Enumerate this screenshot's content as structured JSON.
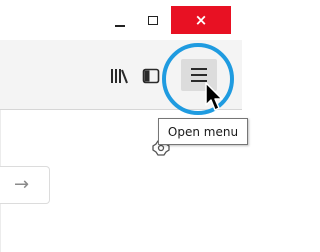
{
  "window_controls": {
    "minimize": "minimize-icon",
    "maximize": "maximize-icon",
    "close": "close-icon",
    "close_glyph": "×",
    "close_color": "#e81123"
  },
  "toolbar": {
    "library": "library-icon",
    "sidebar": "sidebar-icon",
    "menu": "hamburger-icon"
  },
  "tooltip": {
    "text": "Open menu"
  },
  "highlight_color": "#1f9be0",
  "navigation": {
    "forward": "arrow-right-icon",
    "forward_glyph": "→"
  }
}
